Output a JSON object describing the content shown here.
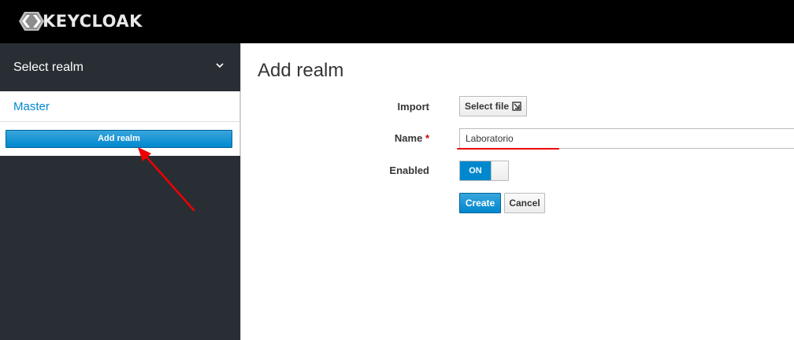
{
  "header": {
    "brand": "KEYCLOAK",
    "logo_icon": "keycloak-logo-icon"
  },
  "sidebar": {
    "realm_selector_label": "Select realm",
    "realm_selector_icon": "chevron-down-icon",
    "realms": [
      {
        "label": "Master"
      }
    ],
    "add_realm_label": "Add realm"
  },
  "main": {
    "title": "Add realm",
    "form": {
      "import_label": "Import",
      "select_file_label": "Select file",
      "select_file_icon": "file-import-icon",
      "name_label": "Name",
      "name_required_marker": "*",
      "name_value": "Laboratorio",
      "enabled_label": "Enabled",
      "enabled_toggle_text": "ON",
      "enabled_state": true,
      "create_label": "Create",
      "cancel_label": "Cancel"
    }
  },
  "colors": {
    "topbar": "#000000",
    "sidebar": "#292e34",
    "accent": "#0088ce",
    "annotation": "#ee0000",
    "required": "#cc0000"
  }
}
